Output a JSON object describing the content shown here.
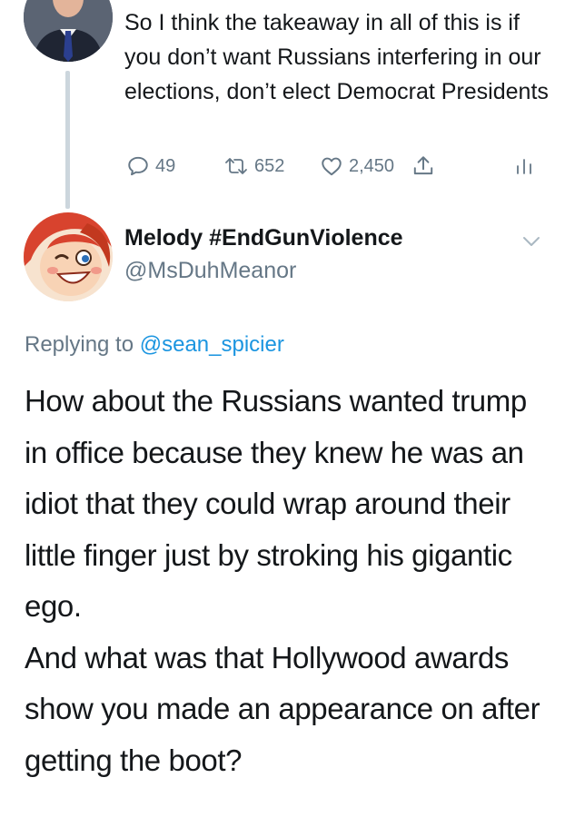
{
  "tweet1": {
    "text": "So I think the takeaway in all of this is if you don’t want Russians interfering in our elections, don’t elect Democrat Presidents",
    "actions": {
      "reply_count": "49",
      "retweet_count": "652",
      "like_count": "2,450"
    },
    "icons": [
      "reply-icon",
      "retweet-icon",
      "like-icon",
      "share-icon",
      "analytics-icon"
    ]
  },
  "tweet2": {
    "display_name": "Melody #EndGunViolence",
    "handle": "@MsDuhMeanor",
    "replying_prefix": "Replying to",
    "replying_to": "@sean_spicier",
    "paragraph1": "How about the Russians wanted trump in office because they knew he was an idiot that they could wrap around their little finger just by stroking his gigantic ego.",
    "paragraph2": "And what was that Hollywood awards show you made an appearance on after getting the boot?"
  },
  "colors": {
    "text": "#14171a",
    "secondary": "#657786",
    "link": "#1b95e0",
    "thread_line": "#ccd6dd"
  }
}
